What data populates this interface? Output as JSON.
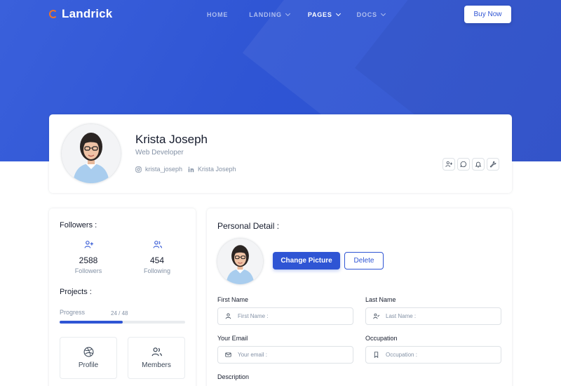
{
  "brand": {
    "name": "Landrick",
    "logo_color": "#f17425"
  },
  "nav": {
    "items": [
      {
        "label": "HOME",
        "dropdown": false,
        "active": false
      },
      {
        "label": "LANDING",
        "dropdown": true,
        "active": false
      },
      {
        "label": "PAGES",
        "dropdown": true,
        "active": true
      },
      {
        "label": "DOCS",
        "dropdown": true,
        "active": false
      }
    ],
    "cta_label": "Buy Now"
  },
  "profile": {
    "name": "Krista Joseph",
    "title": "Web Developer",
    "instagram": "krista_joseph",
    "linkedin": "Krista Joseph",
    "actions": [
      "user-plus-icon",
      "message-circle-icon",
      "bell-icon",
      "tool-icon"
    ]
  },
  "sidebar": {
    "followers_title": "Followers :",
    "followers_count": "2588",
    "followers_label": "Followers",
    "following_count": "454",
    "following_label": "Following",
    "projects_title": "Projects :",
    "progress_label": "Progress",
    "progress_text": "24 / 48",
    "progress_fraction": 0.5,
    "tiles": [
      {
        "label": "Profile",
        "icon": "dribbble-icon"
      },
      {
        "label": "Members",
        "icon": "users-icon"
      }
    ]
  },
  "detail": {
    "title": "Personal Detail :",
    "change_picture": "Change Picture",
    "delete": "Delete",
    "first_name_label": "First Name",
    "first_name_placeholder": "First Name :",
    "last_name_label": "Last Name",
    "last_name_placeholder": "Last Name :",
    "email_label": "Your Email",
    "email_placeholder": "Your email :",
    "occupation_label": "Occupation",
    "occupation_placeholder": "Occupation :",
    "description_label": "Description"
  },
  "colors": {
    "primary": "#2f55d4",
    "muted": "#8492a6",
    "dark": "#161c2d"
  }
}
